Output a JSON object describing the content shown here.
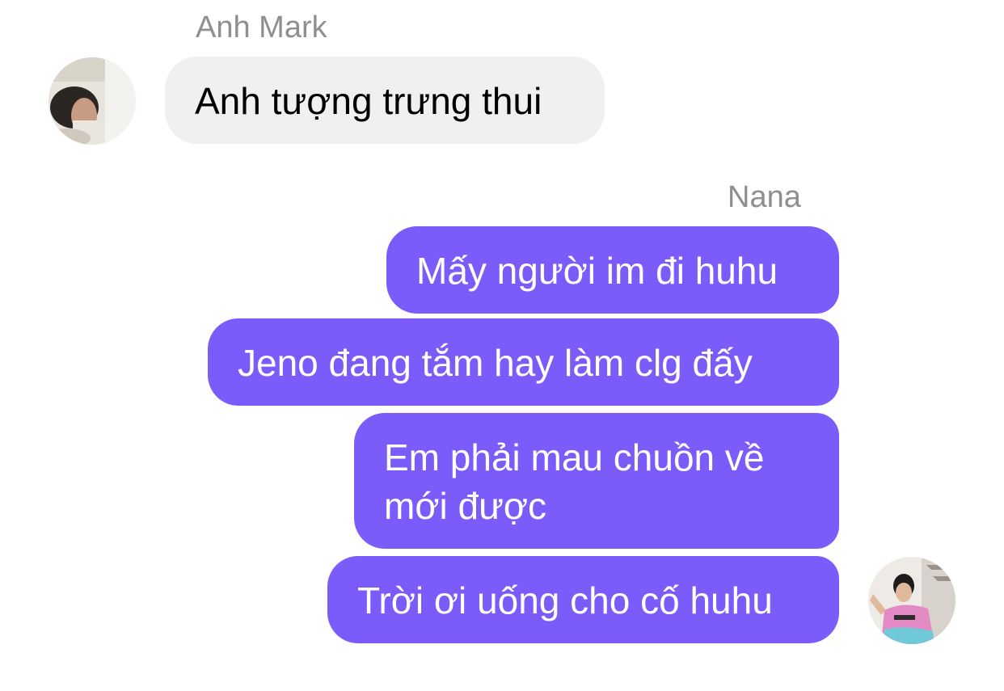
{
  "conversation": {
    "incoming": {
      "sender_name": "Anh Mark",
      "avatar_icon": "user-avatar-photo",
      "messages": [
        {
          "text": "Anh tượng trưng thui"
        }
      ]
    },
    "outgoing": {
      "sender_name": "Nana",
      "avatar_icon": "user-avatar-photo",
      "messages": [
        {
          "text": "Mấy người im đi huhu"
        },
        {
          "text": "Jeno đang tắm hay làm clg đấy"
        },
        {
          "text": "Em phải mau chuồn về mới được"
        },
        {
          "text": "Trời ơi uống cho cố huhu"
        }
      ]
    }
  },
  "colors": {
    "outgoing_bubble": "#7b5cfa",
    "incoming_bubble": "#f0f0f0",
    "sender_name": "#8e8e93"
  }
}
